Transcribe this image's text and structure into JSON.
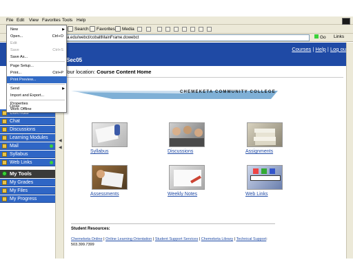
{
  "menubar": {
    "items": [
      "File",
      "Edit",
      "View",
      "Favorites",
      "Tools",
      "Help"
    ]
  },
  "toolbar": {
    "search": "Search",
    "favorites": "Favorites",
    "media": "Media"
  },
  "address": {
    "value": "a.edu/webct/cobaltMainFrame.dowebct",
    "go": "Go",
    "links": "Links"
  },
  "page": {
    "course_title": "Sec05",
    "toplinks": [
      "Courses",
      "Help",
      "Log out"
    ],
    "location_label": "Your location:",
    "location_value": "Course Content Home",
    "college": "CHEMEKETA COMMUNITY COLLEGE"
  },
  "nav": {
    "items": [
      "Calendar",
      "Chat",
      "Discussions",
      "Learning Modules",
      "Mail",
      "Syllabus",
      "Web Links"
    ],
    "tools_heading": "My Tools",
    "tools": [
      "My Grades",
      "My Files",
      "My Progress"
    ]
  },
  "tiles": [
    {
      "label": "Syllabus"
    },
    {
      "label": "Discussions"
    },
    {
      "label": "Assignments"
    },
    {
      "label": "Assessments"
    },
    {
      "label": "Weekly Notes"
    },
    {
      "label": "Web Links"
    }
  ],
  "resources": {
    "title": "Student Resources:",
    "links": [
      "Chemeketa Online",
      "Online Learning Orientation",
      "Student Support Services",
      "Chemeketa Library",
      "Technical Support"
    ],
    "phone": ": 503.399.7399"
  },
  "file_menu": {
    "items": [
      {
        "label": "New",
        "shortcut": ""
      },
      {
        "label": "Open...",
        "shortcut": "Ctrl+O"
      },
      {
        "label": "Edit",
        "shortcut": ""
      },
      {
        "label": "Save",
        "shortcut": "Ctrl+S"
      },
      {
        "label": "Save As...",
        "shortcut": ""
      },
      {
        "label": "Page Setup...",
        "shortcut": ""
      },
      {
        "label": "Print...",
        "shortcut": "Ctrl+P"
      },
      {
        "label": "Print Preview...",
        "shortcut": ""
      },
      {
        "label": "Send",
        "shortcut": ""
      },
      {
        "label": "Import and Export...",
        "shortcut": ""
      },
      {
        "label": "Properties",
        "shortcut": ""
      },
      {
        "label": "Work Offline",
        "shortcut": ""
      },
      {
        "label": "Close",
        "shortcut": ""
      }
    ]
  },
  "colors": {
    "banner": "#1f4aa5",
    "nav": "#2f66c5",
    "menu_highlight": "#316ac5"
  }
}
